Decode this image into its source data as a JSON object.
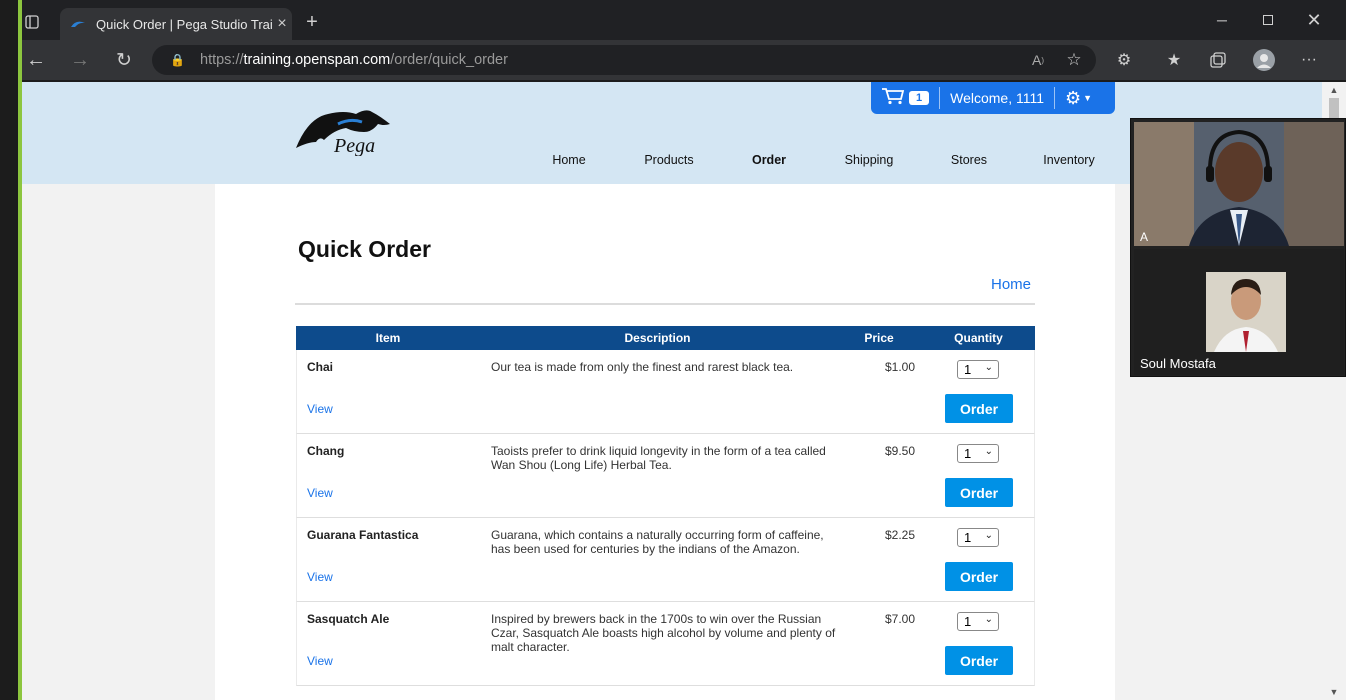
{
  "browser": {
    "tab_title": "Quick Order | Pega Studio Trainin",
    "url_scheme": "https://",
    "url_domain": "training.openspan.com",
    "url_path": "/order/quick_order"
  },
  "site": {
    "logo_text": "Pega",
    "cart_count": "1",
    "welcome": "Welcome, 1111",
    "nav": [
      "Home",
      "Products",
      "Order",
      "Shipping",
      "Stores",
      "Inventory"
    ],
    "active_nav": "Order"
  },
  "page": {
    "title": "Quick Order",
    "home_link": "Home",
    "columns": [
      "Item",
      "Description",
      "Price",
      "Quantity"
    ],
    "view_label": "View",
    "order_label": "Order",
    "products": [
      {
        "name": "Chai",
        "desc": "Our tea is made from only the finest and rarest black tea.",
        "price": "$1.00",
        "qty": "1"
      },
      {
        "name": "Chang",
        "desc": "Taoists prefer to drink liquid longevity in the form of a tea called Wan Shou (Long Life) Herbal Tea.",
        "price": "$9.50",
        "qty": "1"
      },
      {
        "name": "Guarana Fantastica",
        "desc": "Guarana, which contains a naturally occurring form of caffeine, has been used for centuries by the indians of the Amazon.",
        "price": "$2.25",
        "qty": "1"
      },
      {
        "name": "Sasquatch Ale",
        "desc": "Inspired by brewers back in the 1700s to win over the Russian Czar, Sasquatch Ale boasts high alcohol by volume and plenty of malt character.",
        "price": "$7.00",
        "qty": "1"
      }
    ]
  },
  "video": {
    "participant1_initial": "A",
    "participant2_name": "Soul Mostafa"
  },
  "colors": {
    "accent_blue": "#1a73e8",
    "header_bg": "#d4e6f3",
    "table_header": "#0d4b8c",
    "order_button": "#0091e6",
    "share_green": "#34a853",
    "share_red": "#e53935"
  }
}
